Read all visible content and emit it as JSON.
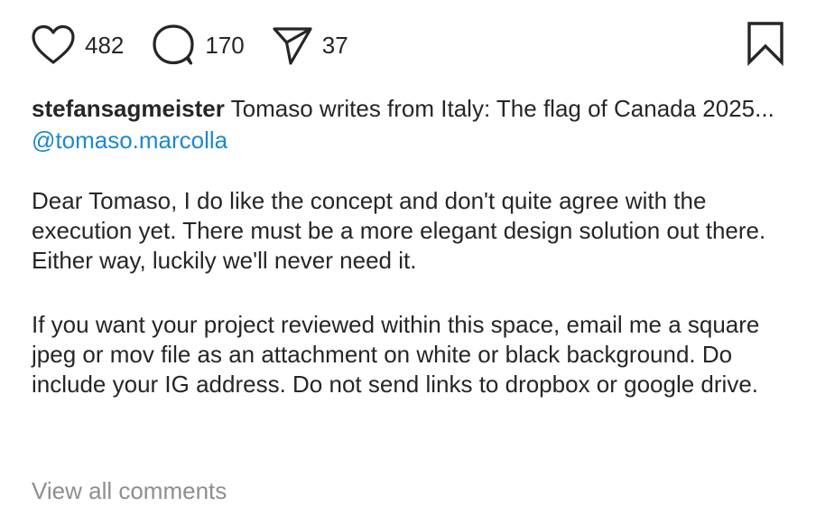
{
  "actions": {
    "likes": "482",
    "comments": "170",
    "shares": "37"
  },
  "icons": {
    "like": "heart-icon",
    "comment": "comment-bubble-icon",
    "share": "paper-plane-icon",
    "save": "bookmark-icon"
  },
  "caption": {
    "username": "stefansagmeister",
    "text": "Tomaso writes from Italy: The flag of Canada 2025...",
    "mention": "@tomaso.marcolla",
    "paragraph_1": "Dear Tomaso,  I do like the concept and don't quite agree with the execution yet. There must be a more elegant design solution out there. Either way, luckily we'll never need it.",
    "paragraph_2": "If you want your project reviewed within this space, email me a square jpeg or mov file as an attachment on white or black background. Do include your IG address. Do not send links to dropbox or google drive."
  },
  "comments_link": "View all comments",
  "colors": {
    "text": "#262626",
    "link": "#1e88cf",
    "muted": "#8e8e8e"
  }
}
